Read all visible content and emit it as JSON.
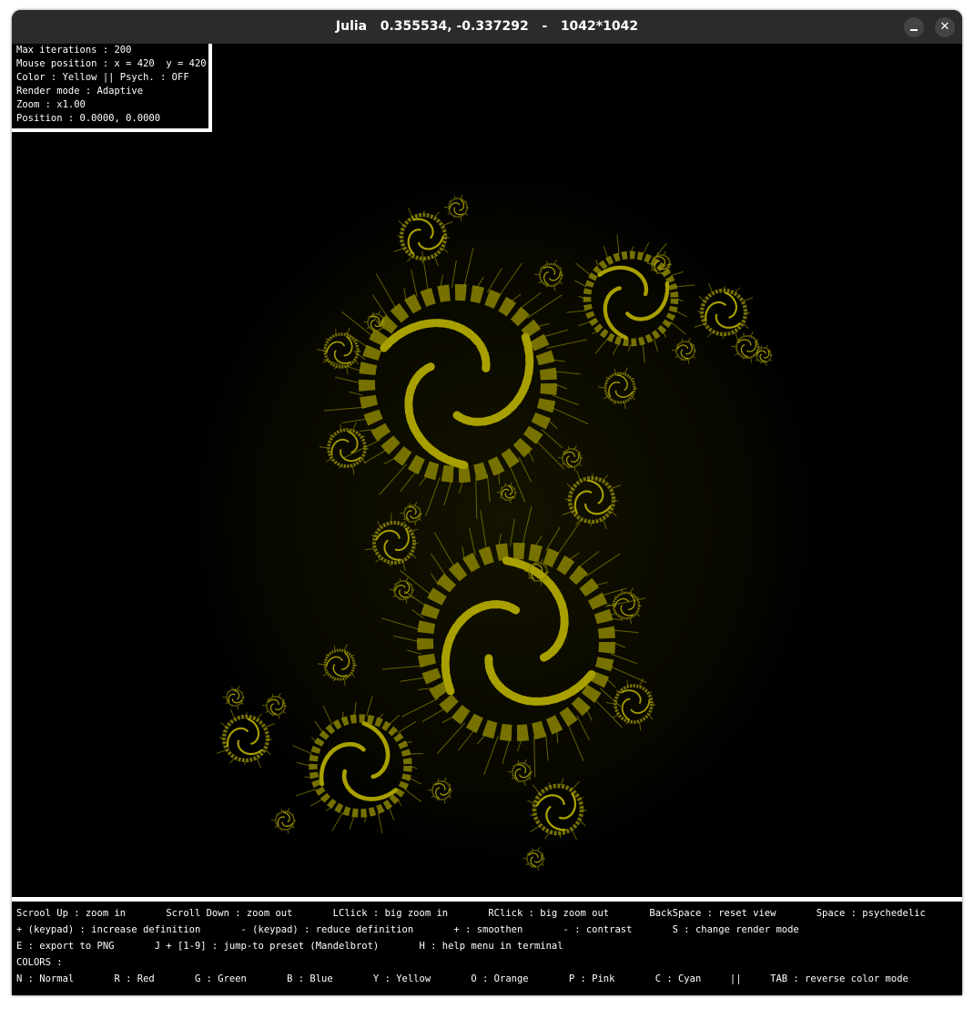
{
  "window": {
    "title": "Julia   0.355534, -0.337292   -   1042*1042",
    "minimize_label": "_",
    "close_label": "✕"
  },
  "info": {
    "max_iterations": "Max iterations : 200",
    "mouse_position": "Mouse position : x = 420  y = 420",
    "color": "Color : Yellow || Psych. : OFF",
    "render_mode": "Render mode : Adaptive",
    "zoom": "Zoom : x1.00",
    "position": "Position : 0.0000, 0.0000"
  },
  "help": {
    "line1": "Scrool Up : zoom in       Scroll Down : zoom out       LClick : big zoom in       RClick : big zoom out       BackSpace : reset view       Space : psychedelic",
    "line2": "+ (keypad) : increase definition       - (keypad) : reduce definition       + : smoothen       - : contrast       S : change render mode",
    "line3": "E : export to PNG       J + [1-9] : jump-to preset (Mandelbrot)       H : help menu in terminal",
    "line4": "COLORS :",
    "line5": "N : Normal       R : Red       G : Green       B : Blue       Y : Yellow       O : Orange       P : Pink       C : Cyan     ||     TAB : reverse color mode"
  },
  "fractal": {
    "color": "#8a8400",
    "bright_color": "#a8a000",
    "glow_color": "#1a1800"
  }
}
